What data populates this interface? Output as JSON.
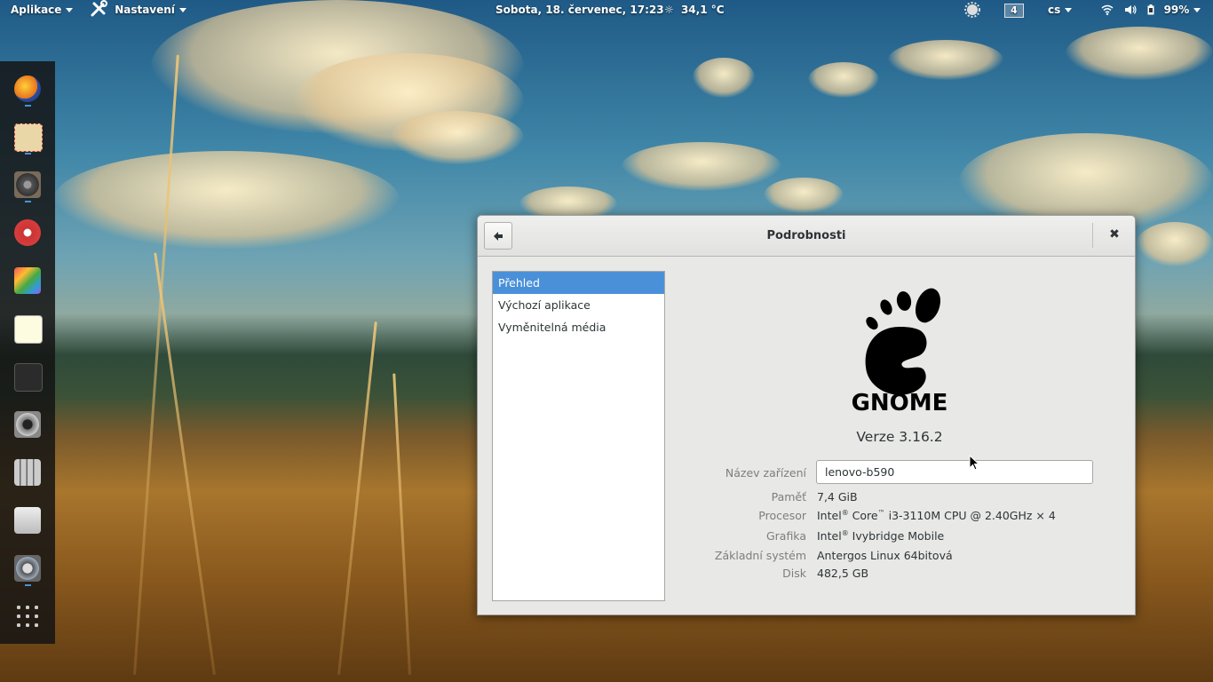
{
  "topbar": {
    "apps_label": "Aplikace",
    "settings_label": "Nastavení",
    "clock": "Sobota, 18. červenec, 17:23",
    "weather": "34,1 °C",
    "workspace": "4",
    "keyboard_layout": "cs",
    "battery": "99%"
  },
  "dock": {
    "items": [
      {
        "icon": "firefox-icon",
        "running": true
      },
      {
        "icon": "mail-icon",
        "running": true
      },
      {
        "icon": "speaker-icon",
        "running": true
      },
      {
        "icon": "disc-burner-icon",
        "running": false
      },
      {
        "icon": "paint-icon",
        "running": false
      },
      {
        "icon": "text-editor-icon",
        "running": false
      },
      {
        "icon": "terminal-icon",
        "running": false
      },
      {
        "icon": "camera-icon",
        "running": false
      },
      {
        "icon": "mixer-icon",
        "running": false
      },
      {
        "icon": "file-manager-icon",
        "running": false
      },
      {
        "icon": "system-settings-icon",
        "running": true
      },
      {
        "icon": "app-grid-icon",
        "running": false
      }
    ]
  },
  "window": {
    "title": "Podrobnosti",
    "sidebar": [
      {
        "label": "Přehled",
        "selected": true
      },
      {
        "label": "Výchozí aplikace",
        "selected": false
      },
      {
        "label": "Vyměnitelná média",
        "selected": false
      }
    ],
    "logo_text": "GNOME",
    "version": "Verze 3.16.2",
    "device_name_label": "Název zařízení",
    "device_name_value": "lenovo-b590",
    "memory_label": "Paměť",
    "memory_value": "7,4 GiB",
    "cpu_label": "Procesor",
    "cpu_brand": "Intel",
    "cpu_core": "Core",
    "cpu_rest": "i3-3110M CPU @ 2.40GHz × 4",
    "graphics_label": "Grafika",
    "graphics_brand": "Intel",
    "graphics_rest": "Ivybridge Mobile",
    "os_label": "Základní systém",
    "os_value": "Antergos Linux 64bitová",
    "disk_label": "Disk",
    "disk_value": "482,5 GB",
    "reg": "®",
    "tm": "™"
  }
}
